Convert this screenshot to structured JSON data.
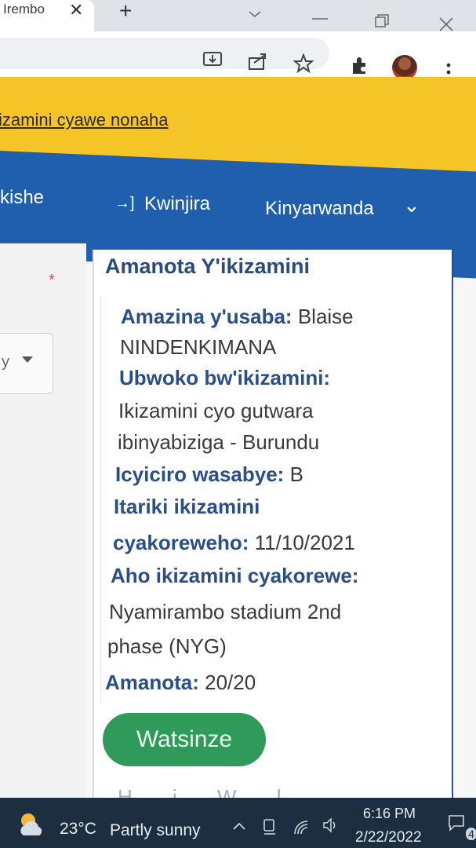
{
  "browser": {
    "tab_title": "Irembo",
    "tab_close": "✕",
    "new_tab": "+",
    "toolbar_icons": [
      "download-icon",
      "share-icon",
      "star-icon",
      "extensions-icon",
      "profile-avatar",
      "menu-icon"
    ]
  },
  "banner": {
    "link_text": "izamini cyawe nonaha"
  },
  "nav": {
    "left_item": "kishe",
    "login_icon": "→]",
    "login_label": "Kwinjira",
    "language_label": "Kinyarwanda",
    "language_caret": "⌄"
  },
  "form": {
    "required_mark": "*",
    "select_value": "y"
  },
  "result": {
    "title": "Amanota Y'ikizamini",
    "applicant_label": "Amazina y'usaba:",
    "applicant_value_1": "Blaise",
    "applicant_value_2": "NINDENKIMANA",
    "exam_type_label": "Ubwoko bw'ikizamini:",
    "exam_type_value_1": "Ikizamini cyo gutwara",
    "exam_type_value_2": "ibinyabiziga - Burundu",
    "category_label": "Icyiciro wasabye:",
    "category_value": "B",
    "date_label_1": "Itariki ikizamini",
    "date_label_2": "cyakoreweho:",
    "date_value": "11/10/2021",
    "location_label": "Aho ikizamini cyakorewe:",
    "location_value_1": "Nyamirambo stadium 2nd",
    "location_value_2": "phase (NYG)",
    "score_label": "Amanota:",
    "score_value": "20/20",
    "status_button": "Watsinze",
    "status_color": "#2f9a59",
    "cutoff_text": "H   i   W   l"
  },
  "taskbar": {
    "temperature": "23°C",
    "weather": "Partly sunny",
    "time": "6:16 PM",
    "date": "2/22/2022",
    "notification_count": "4"
  },
  "colors": {
    "banner": "#f5c528",
    "navbar": "#1f5fae",
    "label": "#2a4f88",
    "taskbar": "#1d2e40"
  }
}
